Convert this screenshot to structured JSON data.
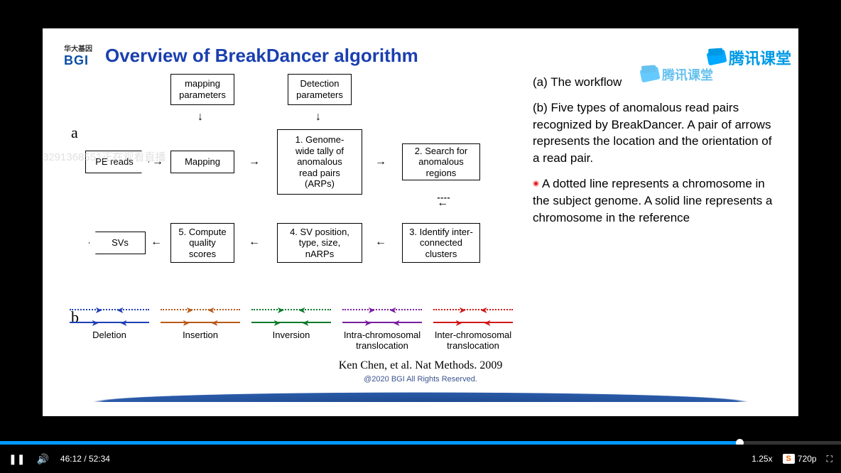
{
  "header": {
    "logo_cn": "华大基因",
    "logo_en": "BGI",
    "title": "Overview of BreakDancer algorithm"
  },
  "labels": {
    "a": "a",
    "b": "b"
  },
  "diagram": {
    "pe_reads": "PE reads",
    "mapping_params": "mapping\nparameters",
    "mapping": "Mapping",
    "detect_params": "Detection\nparameters",
    "step1": "1. Genome-\nwide tally of\nanomalous\nread pairs\n(ARPs)",
    "step2": "2. Search for\nanomalous\nregions",
    "step3": "3. Identify inter-\nconnected\nclusters",
    "step4": "4. SV position,\ntype, size,\nnARPs",
    "step5": "5. Compute\nquality\nscores",
    "svs": "SVs"
  },
  "legend": [
    {
      "name": "Deletion",
      "color": "#1e3fb5"
    },
    {
      "name": "Insertion",
      "color": "#b85a1a"
    },
    {
      "name": "Inversion",
      "color": "#0a7a2a"
    },
    {
      "name": "Intra-chromosomal\ntranslocation",
      "color": "#7a1ea0"
    },
    {
      "name": "Inter-chromosomal\ntranslocation",
      "color": "#d01818"
    }
  ],
  "right": {
    "a": "(a) The workflow",
    "b": "(b) Five types of anomalous read pairs recognized by BreakDancer. A pair of arrows represents the location and the orientation of a read pair.",
    "b2": "A dotted line represents a chromosome in the subject genome. A solid line represents a chromosome in the reference"
  },
  "citation": "Ken Chen, et al. Nat Methods. 2009",
  "footer": "@2020 BGI All Rights Reserved.",
  "watermarks": {
    "viewer": "3291368551正在观看直播",
    "tq": "腾讯课堂"
  },
  "player": {
    "time": "46:12 / 52:34",
    "speed": "1.25x",
    "res": "720p",
    "res_icon": "S"
  }
}
